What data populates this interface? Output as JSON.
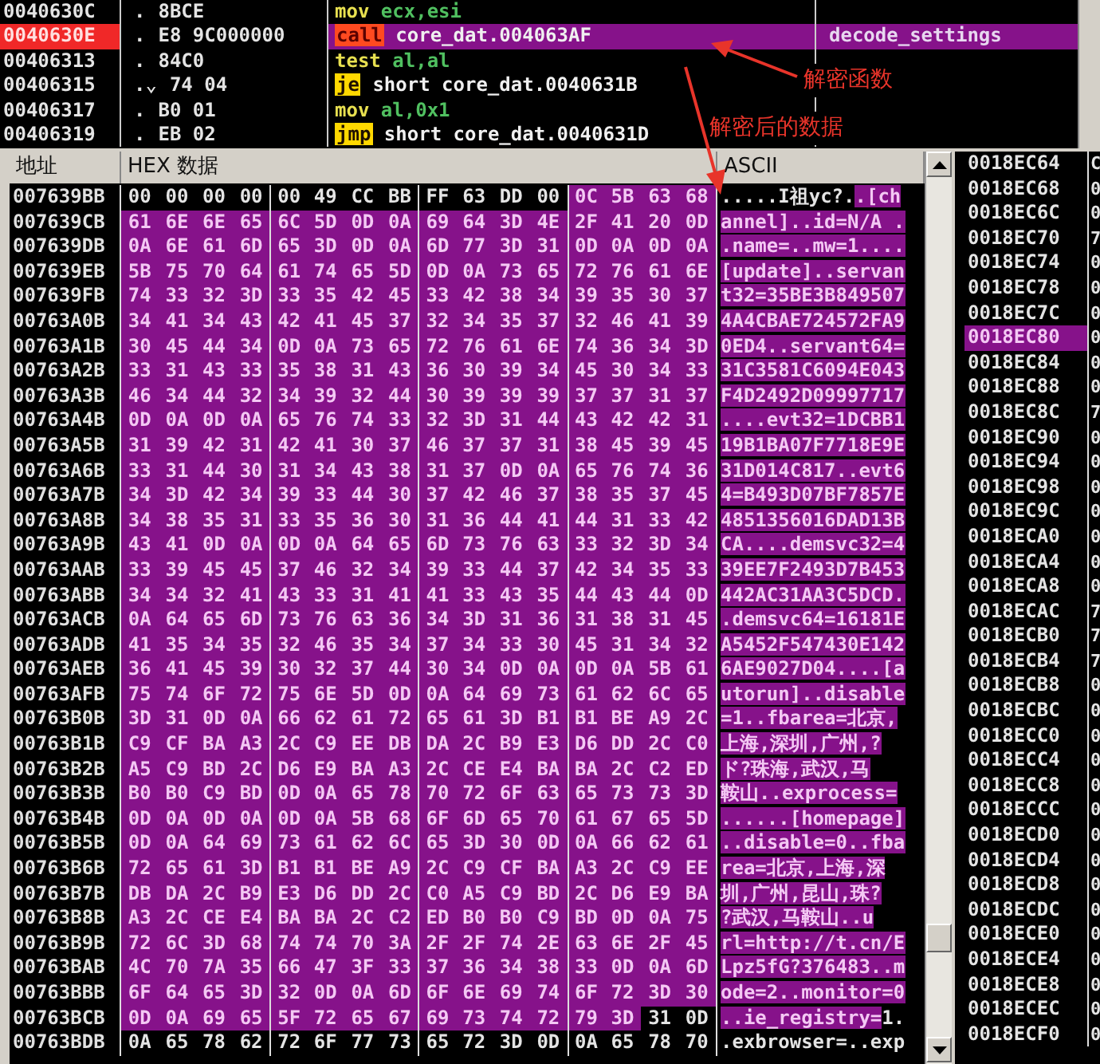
{
  "disassembly": {
    "lines": [
      {
        "address": "0040630C",
        "marker": ".",
        "bytes": "8BCE",
        "mnemonic": {
          "text": "mov",
          "kind": "plain"
        },
        "operands": {
          "text": "ecx,esi",
          "kind": "register"
        },
        "selected": false
      },
      {
        "address": "0040630E",
        "marker": ".",
        "bytes": "E8 9C000000",
        "mnemonic": {
          "text": "call",
          "kind": "call"
        },
        "operands": {
          "text": "core_dat.004063AF",
          "kind": "address"
        },
        "comment": "decode_settings",
        "selected": true
      },
      {
        "address": "00406313",
        "marker": ".",
        "bytes": "84C0",
        "mnemonic": {
          "text": "test",
          "kind": "plain"
        },
        "operands": {
          "text": "al,al",
          "kind": "register"
        },
        "selected": false
      },
      {
        "address": "00406315",
        "marker": ".⌄",
        "bytes": "74 04",
        "mnemonic": {
          "text": "je",
          "kind": "jump"
        },
        "operands": {
          "text": "short core_dat.0040631B",
          "kind": "address"
        },
        "selected": false
      },
      {
        "address": "00406317",
        "marker": ".",
        "bytes": "B0 01",
        "mnemonic": {
          "text": "mov",
          "kind": "plain"
        },
        "operands": {
          "text": "al,0x1",
          "kind": "register"
        },
        "selected": false
      },
      {
        "address": "00406319",
        "marker": ".",
        "bytes": "EB 02",
        "mnemonic": {
          "text": "jmp",
          "kind": "jump"
        },
        "operands": {
          "text": "short core_dat.0040631D",
          "kind": "address"
        },
        "selected": false
      }
    ]
  },
  "annotations": [
    {
      "text": "解密函数"
    },
    {
      "text": "解密后的数据"
    }
  ],
  "dump": {
    "columns": [
      "地址",
      "HEX 数据",
      "ASCII"
    ],
    "rows": [
      {
        "address": "007639BB",
        "hex": [
          {
            "text": "00 00 00 00 00 49 CC BB FF 63 DD 00",
            "selected": false
          },
          {
            "text": "0C 5B 63 68",
            "selected": true
          }
        ],
        "ascii": [
          {
            "text": ".....I祖yc?.",
            "selected": false
          },
          {
            "text": ".[ch",
            "selected": true
          }
        ]
      },
      {
        "address": "007639CB",
        "hex": [
          {
            "text": "61 6E 6E 65 6C 5D 0D 0A 69 64 3D 4E 2F 41 20 0D",
            "selected": true
          }
        ],
        "ascii": [
          {
            "text": "annel]..id=N/A .",
            "selected": true
          }
        ]
      },
      {
        "address": "007639DB",
        "hex": [
          {
            "text": "0A 6E 61 6D 65 3D 0D 0A 6D 77 3D 31 0D 0A 0D 0A",
            "selected": true
          }
        ],
        "ascii": [
          {
            "text": ".name=..mw=1....",
            "selected": true
          }
        ]
      },
      {
        "address": "007639EB",
        "hex": [
          {
            "text": "5B 75 70 64 61 74 65 5D 0D 0A 73 65 72 76 61 6E",
            "selected": true
          }
        ],
        "ascii": [
          {
            "text": "[update]..servan",
            "selected": true
          }
        ]
      },
      {
        "address": "007639FB",
        "hex": [
          {
            "text": "74 33 32 3D 33 35 42 45 33 42 38 34 39 35 30 37",
            "selected": true
          }
        ],
        "ascii": [
          {
            "text": "t32=35BE3B849507",
            "selected": true
          }
        ]
      },
      {
        "address": "00763A0B",
        "hex": [
          {
            "text": "34 41 34 43 42 41 45 37 32 34 35 37 32 46 41 39",
            "selected": true
          }
        ],
        "ascii": [
          {
            "text": "4A4CBAE724572FA9",
            "selected": true
          }
        ]
      },
      {
        "address": "00763A1B",
        "hex": [
          {
            "text": "30 45 44 34 0D 0A 73 65 72 76 61 6E 74 36 34 3D",
            "selected": true
          }
        ],
        "ascii": [
          {
            "text": "0ED4..servant64=",
            "selected": true
          }
        ]
      },
      {
        "address": "00763A2B",
        "hex": [
          {
            "text": "33 31 43 33 35 38 31 43 36 30 39 34 45 30 34 33",
            "selected": true
          }
        ],
        "ascii": [
          {
            "text": "31C3581C6094E043",
            "selected": true
          }
        ]
      },
      {
        "address": "00763A3B",
        "hex": [
          {
            "text": "46 34 44 32 34 39 32 44 30 39 39 39 37 37 31 37",
            "selected": true
          }
        ],
        "ascii": [
          {
            "text": "F4D2492D09997717",
            "selected": true
          }
        ]
      },
      {
        "address": "00763A4B",
        "hex": [
          {
            "text": "0D 0A 0D 0A 65 76 74 33 32 3D 31 44 43 42 42 31",
            "selected": true
          }
        ],
        "ascii": [
          {
            "text": "....evt32=1DCBB1",
            "selected": true
          }
        ]
      },
      {
        "address": "00763A5B",
        "hex": [
          {
            "text": "31 39 42 31 42 41 30 37 46 37 37 31 38 45 39 45",
            "selected": true
          }
        ],
        "ascii": [
          {
            "text": "19B1BA07F7718E9E",
            "selected": true
          }
        ]
      },
      {
        "address": "00763A6B",
        "hex": [
          {
            "text": "33 31 44 30 31 34 43 38 31 37 0D 0A 65 76 74 36",
            "selected": true
          }
        ],
        "ascii": [
          {
            "text": "31D014C817..evt6",
            "selected": true
          }
        ]
      },
      {
        "address": "00763A7B",
        "hex": [
          {
            "text": "34 3D 42 34 39 33 44 30 37 42 46 37 38 35 37 45",
            "selected": true
          }
        ],
        "ascii": [
          {
            "text": "4=B493D07BF7857E",
            "selected": true
          }
        ]
      },
      {
        "address": "00763A8B",
        "hex": [
          {
            "text": "34 38 35 31 33 35 36 30 31 36 44 41 44 31 33 42",
            "selected": true
          }
        ],
        "ascii": [
          {
            "text": "4851356016DAD13B",
            "selected": true
          }
        ]
      },
      {
        "address": "00763A9B",
        "hex": [
          {
            "text": "43 41 0D 0A 0D 0A 64 65 6D 73 76 63 33 32 3D 34",
            "selected": true
          }
        ],
        "ascii": [
          {
            "text": "CA....demsvc32=4",
            "selected": true
          }
        ]
      },
      {
        "address": "00763AAB",
        "hex": [
          {
            "text": "33 39 45 45 37 46 32 34 39 33 44 37 42 34 35 33",
            "selected": true
          }
        ],
        "ascii": [
          {
            "text": "39EE7F2493D7B453",
            "selected": true
          }
        ]
      },
      {
        "address": "00763ABB",
        "hex": [
          {
            "text": "34 34 32 41 43 33 31 41 41 33 43 35 44 43 44 0D",
            "selected": true
          }
        ],
        "ascii": [
          {
            "text": "442AC31AA3C5DCD.",
            "selected": true
          }
        ]
      },
      {
        "address": "00763ACB",
        "hex": [
          {
            "text": "0A 64 65 6D 73 76 63 36 34 3D 31 36 31 38 31 45",
            "selected": true
          }
        ],
        "ascii": [
          {
            "text": ".demsvc64=16181E",
            "selected": true
          }
        ]
      },
      {
        "address": "00763ADB",
        "hex": [
          {
            "text": "41 35 34 35 32 46 35 34 37 34 33 30 45 31 34 32",
            "selected": true
          }
        ],
        "ascii": [
          {
            "text": "A5452F547430E142",
            "selected": true
          }
        ]
      },
      {
        "address": "00763AEB",
        "hex": [
          {
            "text": "36 41 45 39 30 32 37 44 30 34 0D 0A 0D 0A 5B 61",
            "selected": true
          }
        ],
        "ascii": [
          {
            "text": "6AE9027D04....[a",
            "selected": true
          }
        ]
      },
      {
        "address": "00763AFB",
        "hex": [
          {
            "text": "75 74 6F 72 75 6E 5D 0D 0A 64 69 73 61 62 6C 65",
            "selected": true
          }
        ],
        "ascii": [
          {
            "text": "utorun]..disable",
            "selected": true
          }
        ]
      },
      {
        "address": "00763B0B",
        "hex": [
          {
            "text": "3D 31 0D 0A 66 62 61 72 65 61 3D B1 B1 BE A9 2C",
            "selected": true
          }
        ],
        "ascii": [
          {
            "text": "=1..fbarea=北京,",
            "selected": true
          }
        ]
      },
      {
        "address": "00763B1B",
        "hex": [
          {
            "text": "C9 CF BA A3 2C C9 EE DB DA 2C B9 E3 D6 DD 2C C0",
            "selected": true
          }
        ],
        "ascii": [
          {
            "text": "上海,深圳,广州,?",
            "selected": true
          }
        ]
      },
      {
        "address": "00763B2B",
        "hex": [
          {
            "text": "A5 C9 BD 2C D6 E9 BA A3 2C CE E4 BA BA 2C C2 ED",
            "selected": true
          }
        ],
        "ascii": [
          {
            "text": "ド?珠海,武汉,马",
            "selected": true
          }
        ]
      },
      {
        "address": "00763B3B",
        "hex": [
          {
            "text": "B0 B0 C9 BD 0D 0A 65 78 70 72 6F 63 65 73 73 3D",
            "selected": true
          }
        ],
        "ascii": [
          {
            "text": "鞍山..exprocess=",
            "selected": true
          }
        ]
      },
      {
        "address": "00763B4B",
        "hex": [
          {
            "text": "0D 0A 0D 0A 0D 0A 5B 68 6F 6D 65 70 61 67 65 5D",
            "selected": true
          }
        ],
        "ascii": [
          {
            "text": "......[homepage]",
            "selected": true
          }
        ]
      },
      {
        "address": "00763B5B",
        "hex": [
          {
            "text": "0D 0A 64 69 73 61 62 6C 65 3D 30 0D 0A 66 62 61",
            "selected": true
          }
        ],
        "ascii": [
          {
            "text": "..disable=0..fba",
            "selected": true
          }
        ]
      },
      {
        "address": "00763B6B",
        "hex": [
          {
            "text": "72 65 61 3D B1 B1 BE A9 2C C9 CF BA A3 2C C9 EE",
            "selected": true
          }
        ],
        "ascii": [
          {
            "text": "rea=北京,上海,深",
            "selected": true
          }
        ]
      },
      {
        "address": "00763B7B",
        "hex": [
          {
            "text": "DB DA 2C B9 E3 D6 DD 2C C0 A5 C9 BD 2C D6 E9 BA",
            "selected": true
          }
        ],
        "ascii": [
          {
            "text": "圳,广州,昆山,珠?",
            "selected": true
          }
        ]
      },
      {
        "address": "00763B8B",
        "hex": [
          {
            "text": "A3 2C CE E4 BA BA 2C C2 ED B0 B0 C9 BD 0D 0A 75",
            "selected": true
          }
        ],
        "ascii": [
          {
            "text": "?武汉,马鞍山..u",
            "selected": true
          }
        ]
      },
      {
        "address": "00763B9B",
        "hex": [
          {
            "text": "72 6C 3D 68 74 74 70 3A 2F 2F 74 2E 63 6E 2F 45",
            "selected": true
          }
        ],
        "ascii": [
          {
            "text": "rl=http://t.cn/E",
            "selected": true
          }
        ]
      },
      {
        "address": "00763BAB",
        "hex": [
          {
            "text": "4C 70 7A 35 66 47 3F 33 37 36 34 38 33 0D 0A 6D",
            "selected": true
          }
        ],
        "ascii": [
          {
            "text": "Lpz5fG?376483..m",
            "selected": true
          }
        ]
      },
      {
        "address": "00763BBB",
        "hex": [
          {
            "text": "6F 64 65 3D 32 0D 0A 6D 6F 6E 69 74 6F 72 3D 30",
            "selected": true
          }
        ],
        "ascii": [
          {
            "text": "ode=2..monitor=0",
            "selected": true
          }
        ]
      },
      {
        "address": "00763BCB",
        "hex": [
          {
            "text": "0D 0A 69 65 5F 72 65 67 69 73 74 72 79 3D",
            "selected": true
          },
          {
            "text": "31 0D",
            "selected": false
          }
        ],
        "ascii": [
          {
            "text": "..ie_registry=",
            "selected": true
          },
          {
            "text": "1.",
            "selected": false
          }
        ]
      },
      {
        "address": "00763BDB",
        "hex": [
          {
            "text": "0A 65 78 62 72 6F 77 73 65 72 3D 0D 0A 65 78 70",
            "selected": false
          }
        ],
        "ascii": [
          {
            "text": ".exbrowser=..exp",
            "selected": false
          }
        ]
      }
    ]
  },
  "stack": {
    "rows": [
      {
        "address": "0018EC64",
        "value": "C",
        "selected": false
      },
      {
        "address": "0018EC68",
        "value": "0",
        "selected": false
      },
      {
        "address": "0018EC6C",
        "value": "0",
        "selected": false
      },
      {
        "address": "0018EC70",
        "value": "7",
        "selected": false
      },
      {
        "address": "0018EC74",
        "value": "0",
        "selected": false
      },
      {
        "address": "0018EC78",
        "value": "0",
        "selected": false
      },
      {
        "address": "0018EC7C",
        "value": "0",
        "selected": false
      },
      {
        "address": "0018EC80",
        "value": "0",
        "selected": true
      },
      {
        "address": "0018EC84",
        "value": "0",
        "selected": false
      },
      {
        "address": "0018EC88",
        "value": "0",
        "selected": false
      },
      {
        "address": "0018EC8C",
        "value": "7",
        "selected": false
      },
      {
        "address": "0018EC90",
        "value": "0",
        "selected": false
      },
      {
        "address": "0018EC94",
        "value": "0",
        "selected": false
      },
      {
        "address": "0018EC98",
        "value": "0",
        "selected": false
      },
      {
        "address": "0018EC9C",
        "value": "0",
        "selected": false
      },
      {
        "address": "0018ECA0",
        "value": "0",
        "selected": false
      },
      {
        "address": "0018ECA4",
        "value": "0",
        "selected": false
      },
      {
        "address": "0018ECA8",
        "value": "0",
        "selected": false
      },
      {
        "address": "0018ECAC",
        "value": "7",
        "selected": false
      },
      {
        "address": "0018ECB0",
        "value": "7",
        "selected": false
      },
      {
        "address": "0018ECB4",
        "value": "7",
        "selected": false
      },
      {
        "address": "0018ECB8",
        "value": "0",
        "selected": false
      },
      {
        "address": "0018ECBC",
        "value": "0",
        "selected": false
      },
      {
        "address": "0018ECC0",
        "value": "0",
        "selected": false
      },
      {
        "address": "0018ECC4",
        "value": "0",
        "selected": false
      },
      {
        "address": "0018ECC8",
        "value": "0",
        "selected": false
      },
      {
        "address": "0018ECCC",
        "value": "0",
        "selected": false
      },
      {
        "address": "0018ECD0",
        "value": "0",
        "selected": false
      },
      {
        "address": "0018ECD4",
        "value": "0",
        "selected": false
      },
      {
        "address": "0018ECD8",
        "value": "0",
        "selected": false
      },
      {
        "address": "0018ECDC",
        "value": "0",
        "selected": false
      },
      {
        "address": "0018ECE0",
        "value": "0",
        "selected": false
      },
      {
        "address": "0018ECE4",
        "value": "0",
        "selected": false
      },
      {
        "address": "0018ECE8",
        "value": "0",
        "selected": false
      },
      {
        "address": "0018ECEC",
        "value": "0",
        "selected": false
      },
      {
        "address": "0018ECF0",
        "value": "0",
        "selected": false
      }
    ]
  }
}
